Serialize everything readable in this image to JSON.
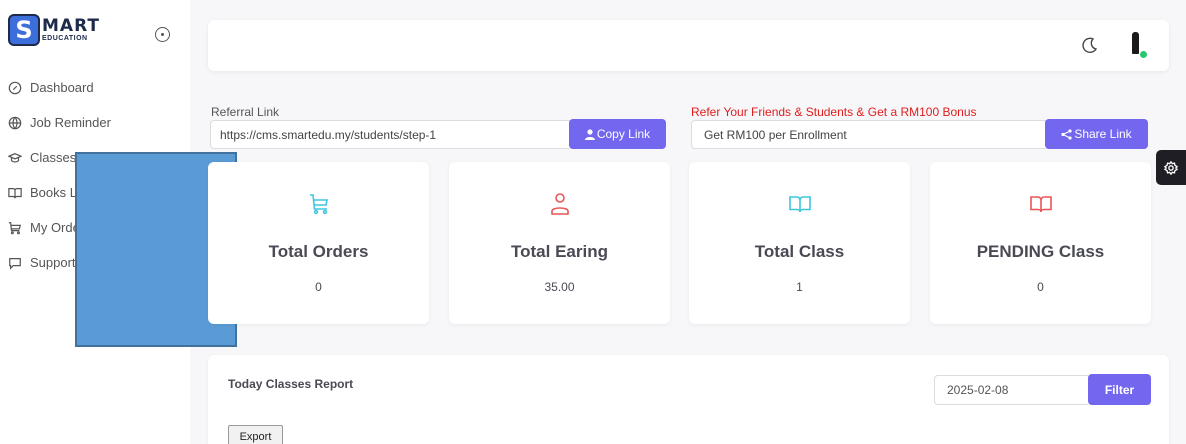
{
  "brand": {
    "main": "MART",
    "sub": "EDUCATION",
    "badge_letter": "S"
  },
  "sidebar": {
    "items": [
      {
        "label": "Dashboard",
        "icon": "dashboard-icon"
      },
      {
        "label": "Job Reminder",
        "icon": "globe-icon"
      },
      {
        "label": "Classes",
        "icon": "graduation-cap-icon"
      },
      {
        "label": "Books L",
        "icon": "book-icon"
      },
      {
        "label": "My Orde",
        "icon": "cart-icon"
      },
      {
        "label": "Support",
        "icon": "chat-icon"
      }
    ]
  },
  "referral": {
    "label": "Referral Link",
    "link": "https://cms.smartedu.my/students/step-1",
    "copy_label": "Copy Link"
  },
  "bonus": {
    "label": "Refer Your Friends & Students & Get a RM100 Bonus",
    "value": "Get RM100 per Enrollment",
    "share_label": "Share Link"
  },
  "stats": [
    {
      "title": "Total Orders",
      "value": "0",
      "icon": "cart-icon",
      "color": "#3ec5e0"
    },
    {
      "title": "Total Earing",
      "value": "35.00",
      "icon": "user-icon",
      "color": "#ea5455"
    },
    {
      "title": "Total Class",
      "value": "1",
      "icon": "book-open-icon",
      "color": "#3ec5e0"
    },
    {
      "title": "PENDING Class",
      "value": "0",
      "icon": "book-open-icon",
      "color": "#ea5455"
    }
  ],
  "report": {
    "title": "Today Classes Report",
    "date": "2025-02-08",
    "filter_label": "Filter",
    "export_label": "Export"
  },
  "colors": {
    "primary": "#7367f0",
    "redact": "#5b9bd5",
    "bonus_text": "#e01d1d"
  }
}
